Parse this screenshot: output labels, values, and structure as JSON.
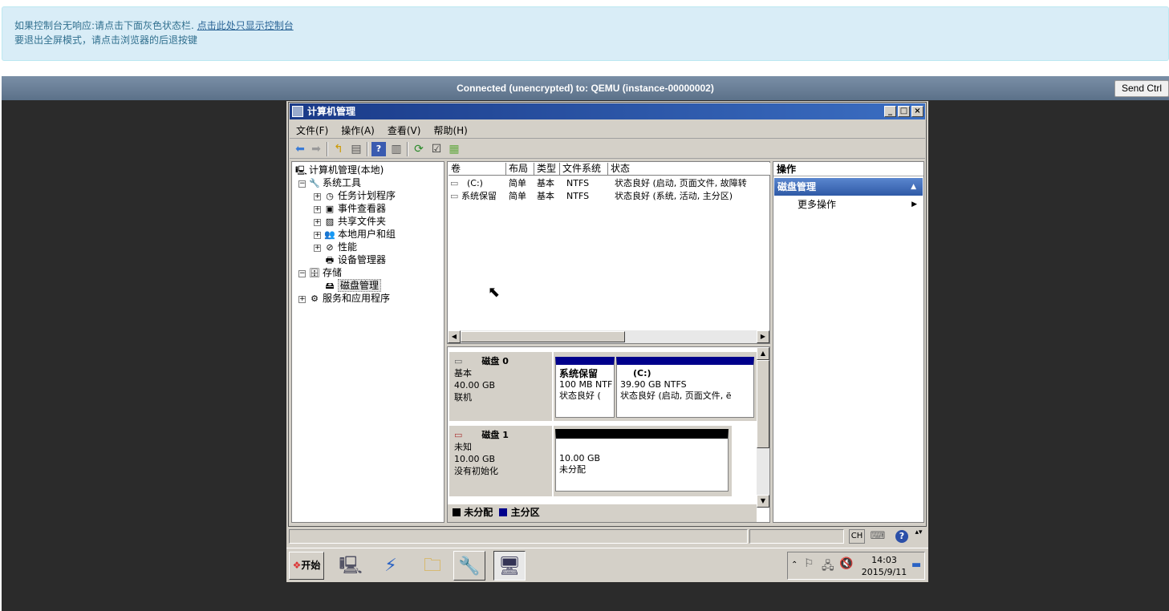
{
  "info": {
    "line1_prefix": "如果控制台无响应:请点击下面灰色状态栏. ",
    "line1_link": "点击此处只显示控制台",
    "line2": "要退出全屏模式，请点击浏览器的后退按键"
  },
  "vnc": {
    "status": "Connected (unencrypted) to: QEMU (instance-00000002)",
    "send_button": "Send Ctrl"
  },
  "window": {
    "title": "计算机管理",
    "min": "_",
    "max": "□",
    "close": "×"
  },
  "menu": [
    "文件(F)",
    "操作(A)",
    "查看(V)",
    "帮助(H)"
  ],
  "tree": {
    "root": "计算机管理(本地)",
    "system_tools": "系统工具",
    "task_scheduler": "任务计划程序",
    "event_viewer": "事件查看器",
    "shared_folders": "共享文件夹",
    "local_users": "本地用户和组",
    "performance": "性能",
    "device_manager": "设备管理器",
    "storage": "存储",
    "disk_management": "磁盘管理",
    "services_apps": "服务和应用程序"
  },
  "volumes": {
    "headers": [
      "卷",
      "布局",
      "类型",
      "文件系统",
      "状态"
    ],
    "rows": [
      [
        "(C:)",
        "简单",
        "基本",
        "NTFS",
        "状态良好 (启动, 页面文件, 故障转"
      ],
      [
        "系统保留",
        "简单",
        "基本",
        "NTFS",
        "状态良好 (系统, 活动, 主分区)"
      ]
    ]
  },
  "disks": [
    {
      "name": "磁盘 0",
      "type": "基本",
      "size": "40.00 GB",
      "state": "联机"
    },
    {
      "name": "磁盘 1",
      "type": "未知",
      "size": "10.00 GB",
      "state": "没有初始化"
    }
  ],
  "partitions": {
    "sys_name": "系统保留",
    "sys_size": "100 MB NTF",
    "sys_status": "状态良好 (",
    "c_name": "(C:)",
    "c_size": "39.90 GB NTFS",
    "c_status": "状态良好 (启动, 页面文件, ë",
    "un_size": "10.00 GB",
    "un_label": "未分配"
  },
  "legend": {
    "unallocated": "未分配",
    "primary": "主分区"
  },
  "actions": {
    "header": "操作",
    "section": "磁盘管理",
    "more": "更多操作"
  },
  "statusbar": {
    "lang": "CH"
  },
  "taskbar": {
    "start": "开始",
    "time": "14:03",
    "date": "2015/9/11"
  },
  "colors": {
    "primary_partition": "#00008b",
    "unallocated": "#000000",
    "actions_header": "#3b6ec2"
  }
}
